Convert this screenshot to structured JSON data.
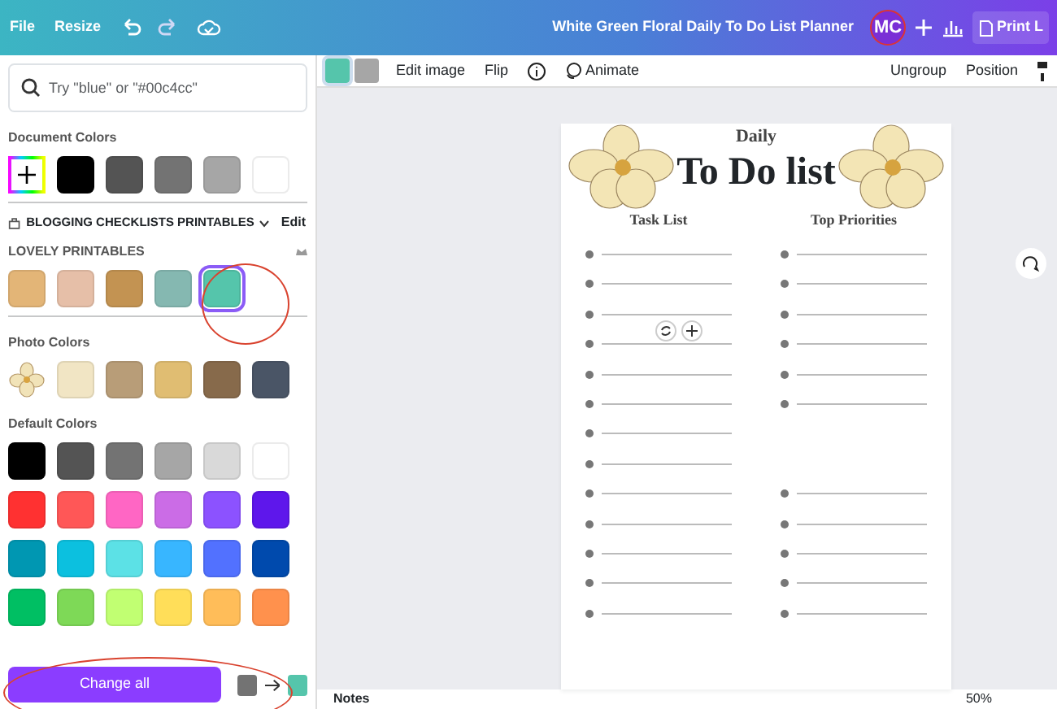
{
  "topbar": {
    "menu": [
      {
        "label": "File"
      },
      {
        "label": "Resize"
      }
    ],
    "title": "White Green Floral Daily To Do List Planner",
    "avatar": "MC",
    "share_label": "Print L"
  },
  "panel": {
    "search": {
      "placeholder": "Try \"blue\" or \"#00c4cc\""
    },
    "document_colors": {
      "label": "Document Colors",
      "swatches": [
        {
          "color": "#000000"
        },
        {
          "color": "#545454"
        },
        {
          "color": "#737373"
        },
        {
          "color": "#a6a6a6"
        },
        {
          "color": "#ffffff"
        }
      ]
    },
    "brand_kit": {
      "name": "BLOGGING CHECKLISTS PRINTABLES",
      "edit": "Edit",
      "palette": "LOVELY PRINTABLES",
      "swatches": [
        {
          "color": "#e3b577",
          "selected": false
        },
        {
          "color": "#e6bfa8",
          "selected": false
        },
        {
          "color": "#c39352",
          "selected": false
        },
        {
          "color": "#85b8b1",
          "selected": false
        },
        {
          "color": "#55c5ab",
          "selected": true
        }
      ]
    },
    "photo_colors": {
      "label": "Photo Colors",
      "swatches": [
        {
          "color": "#f1e5c4"
        },
        {
          "color": "#b89d78"
        },
        {
          "color": "#e0bd72"
        },
        {
          "color": "#876a4b"
        },
        {
          "color": "#4a5566"
        }
      ]
    },
    "default_colors": {
      "label": "Default Colors",
      "swatches": [
        {
          "color": "#000000"
        },
        {
          "color": "#545454"
        },
        {
          "color": "#737373"
        },
        {
          "color": "#a6a6a6"
        },
        {
          "color": "#d9d9d9"
        },
        {
          "color": "#ffffff"
        },
        {
          "color": "#ff3131"
        },
        {
          "color": "#ff5757"
        },
        {
          "color": "#ff66c4"
        },
        {
          "color": "#cb6ce6"
        },
        {
          "color": "#8c52ff"
        },
        {
          "color": "#5e17eb"
        },
        {
          "color": "#0097b2"
        },
        {
          "color": "#0cc0df"
        },
        {
          "color": "#5ce1e6"
        },
        {
          "color": "#38b6ff"
        },
        {
          "color": "#5271ff"
        },
        {
          "color": "#004aad"
        },
        {
          "color": "#00bf63"
        },
        {
          "color": "#7ed957"
        },
        {
          "color": "#c1ff72"
        },
        {
          "color": "#ffde59"
        },
        {
          "color": "#ffbd59"
        },
        {
          "color": "#ff914d"
        }
      ]
    },
    "change_all": {
      "label": "Change all",
      "colors": [
        {
          "color": "#737373"
        },
        {
          "color": "#55c5ab"
        }
      ]
    }
  },
  "toolbar": {
    "color_chips": [
      {
        "color": "#55c5ab",
        "selected": true
      },
      {
        "color": "#a6a6a6",
        "selected": false
      }
    ],
    "buttons": [
      {
        "label": "Edit image"
      },
      {
        "label": "Flip"
      }
    ],
    "animate": "Animate",
    "right_buttons": [
      {
        "label": "Ungroup"
      },
      {
        "label": "Position"
      }
    ]
  },
  "page": {
    "subtitle": "Daily",
    "title": "To Do list",
    "columns": [
      {
        "heading": "Task List"
      },
      {
        "heading": "Top Priorities"
      }
    ]
  },
  "bottom": {
    "notes": "Notes",
    "zoom": "50%"
  }
}
